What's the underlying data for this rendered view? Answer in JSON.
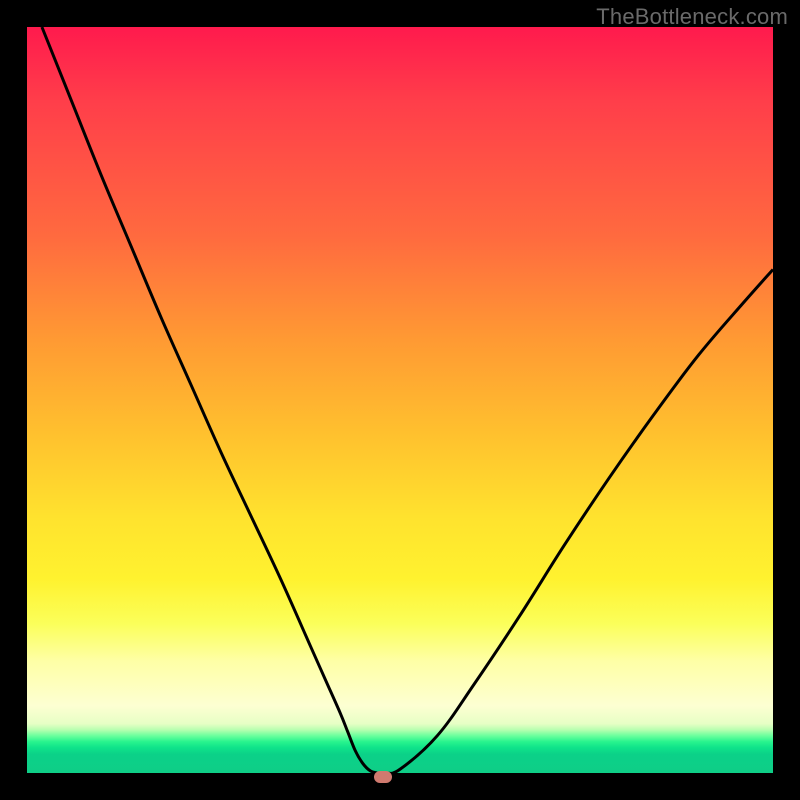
{
  "watermark": "TheBottleneck.com",
  "chart_data": {
    "type": "line",
    "title": "",
    "xlabel": "",
    "ylabel": "",
    "xlim": [
      0,
      100
    ],
    "ylim": [
      0,
      100
    ],
    "series": [
      {
        "name": "curve",
        "x": [
          2,
          6,
          10,
          14,
          18,
          22,
          26,
          30,
          34,
          38,
          40,
          42,
          43,
          44,
          45,
          46,
          47,
          48,
          50,
          55,
          60,
          66,
          72,
          78,
          84,
          90,
          96,
          100
        ],
        "y": [
          100,
          90,
          80,
          70.5,
          61,
          52,
          43,
          34.5,
          26,
          17,
          12.5,
          8,
          5.5,
          3,
          1.3,
          0.3,
          0,
          0,
          0.5,
          5,
          12,
          21,
          30.5,
          39.5,
          48,
          56,
          63,
          67.5
        ]
      }
    ],
    "marker": {
      "x": 47.5,
      "y": 0
    },
    "gradient_stops": [
      {
        "pos": 0.0,
        "color": "#ff1a4d"
      },
      {
        "pos": 0.42,
        "color": "#ff9a33"
      },
      {
        "pos": 0.75,
        "color": "#fff22f"
      },
      {
        "pos": 0.95,
        "color": "#29f48e"
      },
      {
        "pos": 1.0,
        "color": "#0fce87"
      }
    ]
  }
}
